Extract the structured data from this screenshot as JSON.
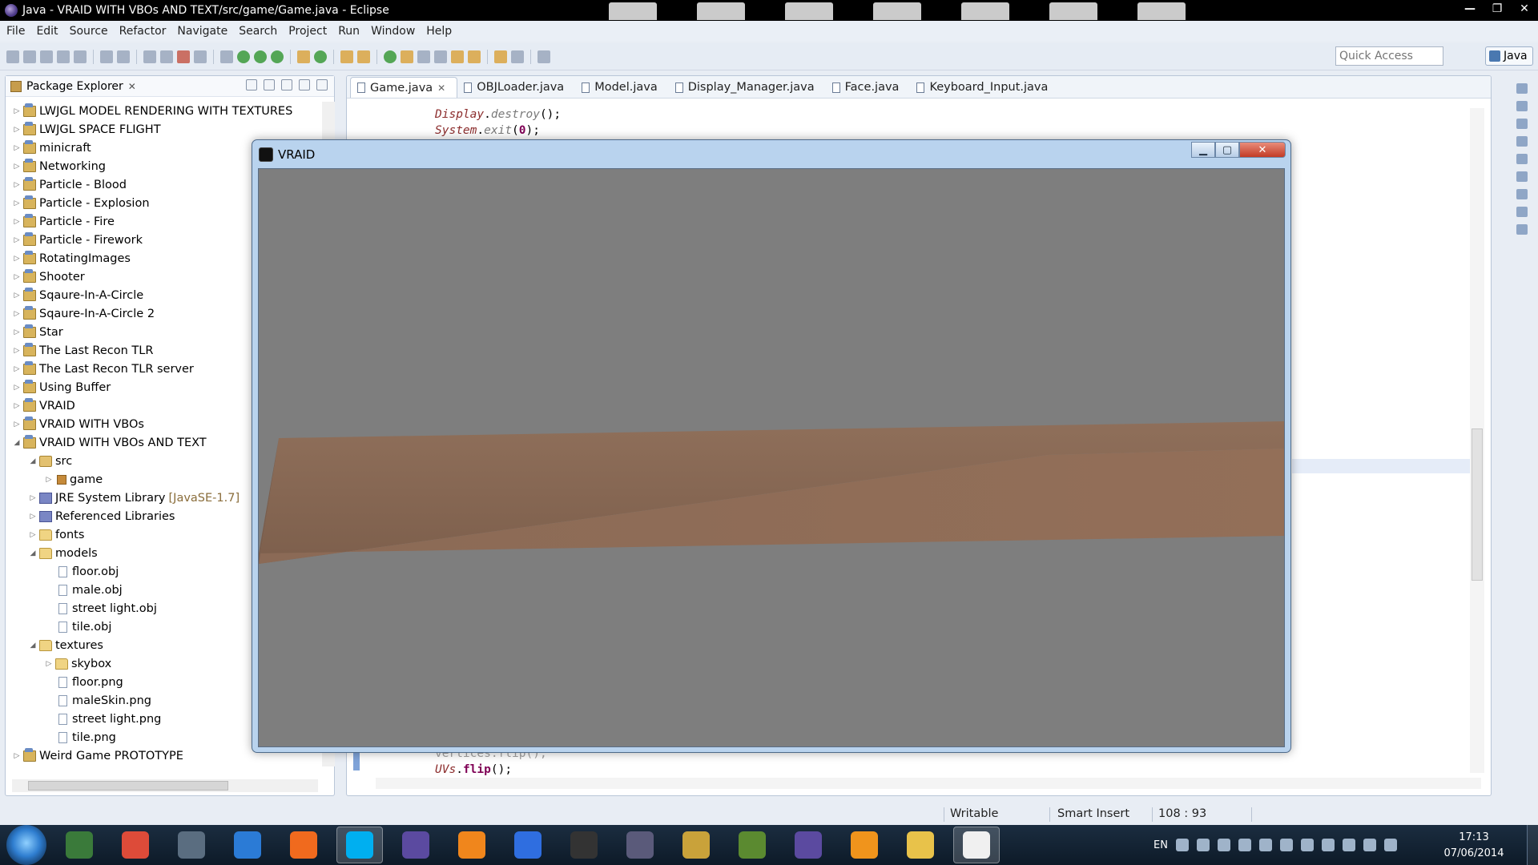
{
  "window": {
    "title": "Java - VRAID WITH VBOs AND TEXT/src/game/Game.java - Eclipse",
    "controls": [
      "—",
      "❐",
      "✕"
    ]
  },
  "menu": [
    "File",
    "Edit",
    "Source",
    "Refactor",
    "Navigate",
    "Search",
    "Project",
    "Run",
    "Window",
    "Help"
  ],
  "toolbar": {
    "quick_access_placeholder": "Quick Access",
    "perspective_label": "Java"
  },
  "package_explorer": {
    "title": "Package Explorer",
    "tree": [
      {
        "label": "LWJGL MODEL RENDERING WITH TEXTURES",
        "indent": 0,
        "type": "project",
        "state": "collapsed"
      },
      {
        "label": "LWJGL SPACE FLIGHT",
        "indent": 0,
        "type": "project",
        "state": "collapsed"
      },
      {
        "label": "minicraft",
        "indent": 0,
        "type": "project",
        "state": "collapsed"
      },
      {
        "label": "Networking",
        "indent": 0,
        "type": "project",
        "state": "collapsed"
      },
      {
        "label": "Particle - Blood",
        "indent": 0,
        "type": "project",
        "state": "collapsed"
      },
      {
        "label": "Particle - Explosion",
        "indent": 0,
        "type": "project",
        "state": "collapsed"
      },
      {
        "label": "Particle - Fire",
        "indent": 0,
        "type": "project",
        "state": "collapsed"
      },
      {
        "label": "Particle - Firework",
        "indent": 0,
        "type": "project",
        "state": "collapsed"
      },
      {
        "label": "RotatingImages",
        "indent": 0,
        "type": "project",
        "state": "collapsed"
      },
      {
        "label": "Shooter",
        "indent": 0,
        "type": "project",
        "state": "collapsed"
      },
      {
        "label": "Sqaure-In-A-Circle",
        "indent": 0,
        "type": "project",
        "state": "collapsed"
      },
      {
        "label": "Sqaure-In-A-Circle 2",
        "indent": 0,
        "type": "project",
        "state": "collapsed"
      },
      {
        "label": "Star",
        "indent": 0,
        "type": "project",
        "state": "collapsed"
      },
      {
        "label": "The Last Recon TLR",
        "indent": 0,
        "type": "project",
        "state": "collapsed"
      },
      {
        "label": "The Last Recon TLR server",
        "indent": 0,
        "type": "project",
        "state": "collapsed"
      },
      {
        "label": "Using Buffer",
        "indent": 0,
        "type": "project",
        "state": "collapsed"
      },
      {
        "label": "VRAID",
        "indent": 0,
        "type": "project",
        "state": "collapsed"
      },
      {
        "label": "VRAID WITH VBOs",
        "indent": 0,
        "type": "project",
        "state": "collapsed"
      },
      {
        "label": "VRAID WITH VBOs AND TEXT",
        "indent": 0,
        "type": "project",
        "state": "expanded"
      },
      {
        "label": "src",
        "indent": 1,
        "type": "src",
        "state": "expanded"
      },
      {
        "label": "game",
        "indent": 2,
        "type": "package",
        "state": "collapsed"
      },
      {
        "label": "JRE System Library",
        "suffix": "[JavaSE-1.7]",
        "indent": 1,
        "type": "library",
        "state": "collapsed"
      },
      {
        "label": "Referenced Libraries",
        "indent": 1,
        "type": "library",
        "state": "collapsed"
      },
      {
        "label": "fonts",
        "indent": 1,
        "type": "folder",
        "state": "collapsed"
      },
      {
        "label": "models",
        "indent": 1,
        "type": "folder",
        "state": "expanded"
      },
      {
        "label": "floor.obj",
        "indent": 2,
        "type": "file",
        "state": "none"
      },
      {
        "label": "male.obj",
        "indent": 2,
        "type": "file",
        "state": "none"
      },
      {
        "label": "street light.obj",
        "indent": 2,
        "type": "file",
        "state": "none"
      },
      {
        "label": "tile.obj",
        "indent": 2,
        "type": "file",
        "state": "none"
      },
      {
        "label": "textures",
        "indent": 1,
        "type": "folder",
        "state": "expanded"
      },
      {
        "label": "skybox",
        "indent": 2,
        "type": "folder",
        "state": "collapsed"
      },
      {
        "label": "floor.png",
        "indent": 2,
        "type": "file",
        "state": "none"
      },
      {
        "label": "maleSkin.png",
        "indent": 2,
        "type": "file",
        "state": "none"
      },
      {
        "label": "street light.png",
        "indent": 2,
        "type": "file",
        "state": "none"
      },
      {
        "label": "tile.png",
        "indent": 2,
        "type": "file",
        "state": "none"
      },
      {
        "label": "Weird Game PROTOTYPE",
        "indent": 0,
        "type": "project",
        "state": "collapsed"
      }
    ]
  },
  "editor": {
    "tabs": [
      {
        "label": "Game.java",
        "active": true
      },
      {
        "label": "OBJLoader.java",
        "active": false
      },
      {
        "label": "Model.java",
        "active": false
      },
      {
        "label": "Display_Manager.java",
        "active": false
      },
      {
        "label": "Face.java",
        "active": false
      },
      {
        "label": "Keyboard_Input.java",
        "active": false
      }
    ],
    "code_top": {
      "line1_obj": "Display",
      "line1_method": "destroy",
      "line1_rest": "();",
      "line2_obj": "System",
      "line2_method": "exit",
      "line2_arg": "0",
      "line2_rest": ");"
    },
    "code_bottom": {
      "line1": "vertices.flip();",
      "line2_obj": "UVs",
      "line2_method": "flip",
      "line2_rest": "();"
    }
  },
  "vraid_window": {
    "title": "VRAID",
    "viewport_bg": "#7e7e7e",
    "plank_color": "#8a6a55"
  },
  "statusbar": {
    "mode": "Writable",
    "insert": "Smart Insert",
    "position": "108 : 93"
  },
  "taskbar": {
    "apps": [
      {
        "name": "task-manager",
        "color": "#3a7a3a"
      },
      {
        "name": "chrome",
        "color": "#dd4b39"
      },
      {
        "name": "steam",
        "color": "#5a6d80"
      },
      {
        "name": "uplay",
        "color": "#2b7bd6"
      },
      {
        "name": "origin",
        "color": "#f06a1e"
      },
      {
        "name": "skype",
        "color": "#00aff0"
      },
      {
        "name": "eclipse",
        "color": "#5b4aa0"
      },
      {
        "name": "blender",
        "color": "#f0861c"
      },
      {
        "name": "shield-app",
        "color": "#2f6ee0"
      },
      {
        "name": "arma",
        "color": "#333333"
      },
      {
        "name": "game-app",
        "color": "#5a5a7a"
      },
      {
        "name": "sc-app",
        "color": "#c9a23a"
      },
      {
        "name": "minecraft",
        "color": "#5b8a30"
      },
      {
        "name": "eclipse-2",
        "color": "#5b4aa0"
      },
      {
        "name": "media-player",
        "color": "#f0941c"
      },
      {
        "name": "explorer",
        "color": "#e8c24a"
      },
      {
        "name": "vraid-app",
        "color": "#f0f0f0"
      }
    ],
    "language": "EN",
    "time": "17:13",
    "date": "07/06/2014"
  }
}
